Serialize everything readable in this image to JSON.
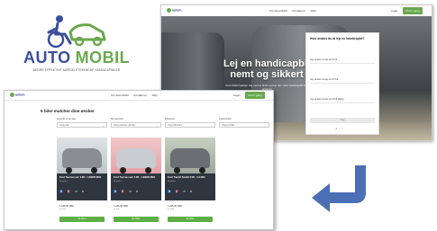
{
  "logo": {
    "word1": "AUTO",
    "word2": "MOBIL",
    "tagline": "BEDRE EFFEKTIVE KØRSELSTEKNIK AF HANDICAPBILER"
  },
  "hero_page": {
    "nav": {
      "brand": "autom",
      "links": [
        "Om Auto Mobil",
        "Kontakt os",
        "FAQ"
      ],
      "login": "Login",
      "cta": "Kom i gang"
    },
    "headline": "Lej en handicapbil nemt og sikkert",
    "subtext": "Auto Mobil hjælper dig med at finde og leje den rette handicapbil til din situation.",
    "form": {
      "title": "Hvor ønsker du at leje en handicapbil?",
      "questions": [
        "Jeg ønsker at leje en bil til...",
        "Jeg ønsker at leje en bil fra...",
        "Jeg ønsker at leje en bil til (dato)..."
      ],
      "button": "Søg"
    }
  },
  "listing_page": {
    "nav": {
      "brand": "autom",
      "links": [
        "Om Auto Mobil",
        "Kontakt os",
        "FAQ"
      ],
      "login": "Login",
      "cta": "Kom i gang"
    },
    "title": "5 biler matcher dine ønsker",
    "filters": [
      {
        "label": "Hvornår vil du leje",
        "value": "Vælg dato"
      },
      {
        "label": "Bil-størrelse",
        "value": "Vælg størrelse på bilen"
      },
      {
        "label": "Bilmærke",
        "value": "Vælg bilmærke"
      },
      {
        "label": "Lejeområde",
        "value": "Vælg område"
      }
    ],
    "cars": [
      {
        "name": "Ford Tourneo aut. 2.0D - 1.09900 DKK",
        "sub": "Bruxelles",
        "icons": "♿ ⛽ ⚙ ⚙",
        "price": "1.245,00 DKK",
        "price_note": "pr. dag",
        "button": "Se bilen",
        "color": "#8a8d92"
      },
      {
        "name": "Ford Tourneo aut. 2.0D - 1.09900 DKK",
        "sub": "Bruxelles",
        "icons": "♿ ⛽ ⚙ ⚙",
        "price": "1.245,00 DKK",
        "price_note": "pr. dag",
        "button": "Se bilen",
        "color": "#c9ccd0"
      },
      {
        "name": "Ford Transit Kombi 2.0D - 1.2 MIO",
        "sub": "Bruxelles",
        "icons": "♿ ⛽ ⚙ ⚙",
        "price": "1.245,00 DKK",
        "price_note": "pr. dag",
        "button": "Se bilen",
        "color": "#6b6f74"
      }
    ]
  },
  "colors": {
    "brand_blue": "#3b4f9c",
    "brand_green": "#6aa84f",
    "arrow_blue": "#4a6fb5"
  },
  "icons": {
    "arrow": "return-arrow-icon"
  }
}
